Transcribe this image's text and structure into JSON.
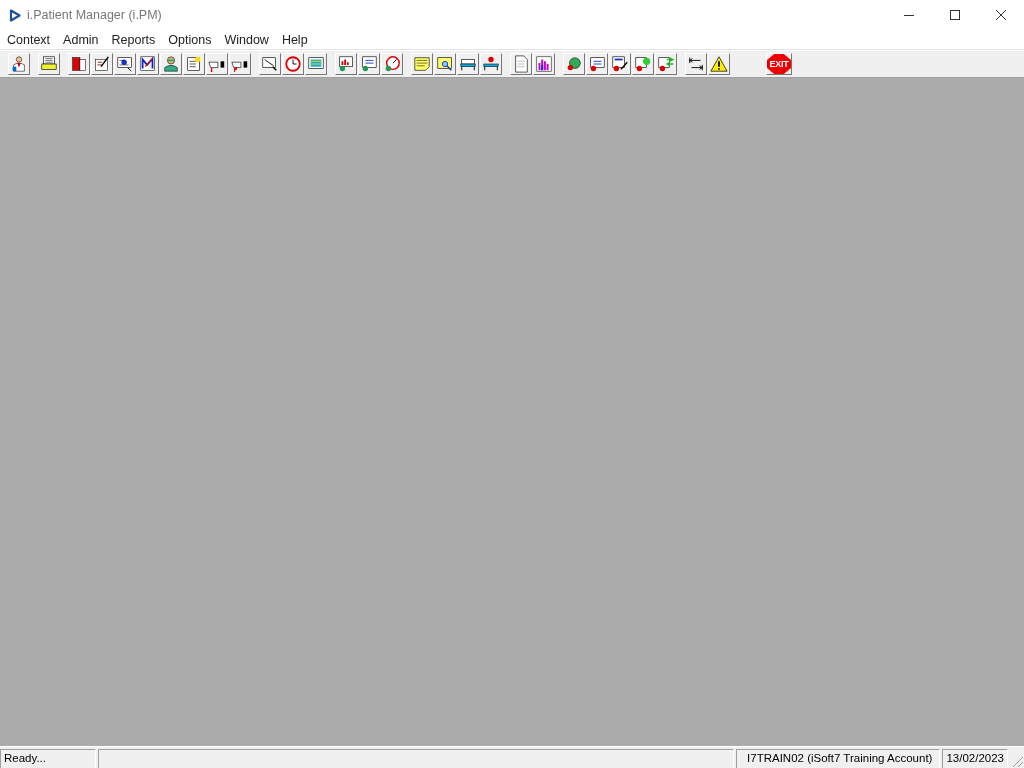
{
  "window": {
    "title": "i.Patient Manager (i.PM)"
  },
  "menu": [
    "Context",
    "Admin",
    "Reports",
    "Options",
    "Window",
    "Help"
  ],
  "toolbar": {
    "exit_label": "EXIT"
  },
  "status_bar": {
    "message": "Ready...",
    "user": "I7TRAIN02 (iSoft7 Training Account)",
    "date": "13/02/2023"
  }
}
